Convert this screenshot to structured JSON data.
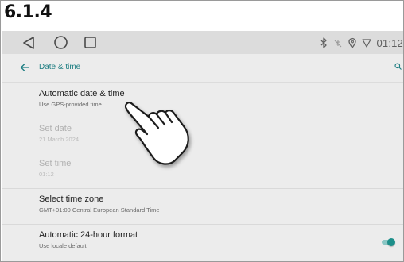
{
  "section": {
    "label": "6.1.4"
  },
  "navbar": {
    "back_icon": "triangle-back-icon",
    "home_icon": "circle-home-icon",
    "recents_icon": "square-recents-icon"
  },
  "status_bar": {
    "icons": [
      "bluetooth-icon",
      "wifi-off-icon",
      "location-icon",
      "signal-icon"
    ],
    "time": "01:12"
  },
  "app_bar": {
    "title": "Date & time",
    "back_icon": "arrow-back-icon",
    "search_icon": "search-icon"
  },
  "settings": [
    {
      "title": "Automatic date & time",
      "subtitle": "Use GPS-provided time",
      "enabled": true
    },
    {
      "title": "Set date",
      "subtitle": "21 March 2024",
      "enabled": false
    },
    {
      "title": "Set time",
      "subtitle": "01:12",
      "enabled": false
    },
    {
      "title": "Select time zone",
      "subtitle": "GMT+01:00 Central European Standard Time",
      "enabled": true
    },
    {
      "title": "Automatic 24-hour format",
      "subtitle": "Use locale default",
      "enabled": true,
      "toggle": true
    }
  ],
  "colors": {
    "accent": "#1e7e82",
    "toggle_on": "#1d8f8a",
    "background": "#ececec",
    "navbar": "#dcdcdc"
  },
  "overlay": {
    "icon": "pointing-hand-icon"
  }
}
